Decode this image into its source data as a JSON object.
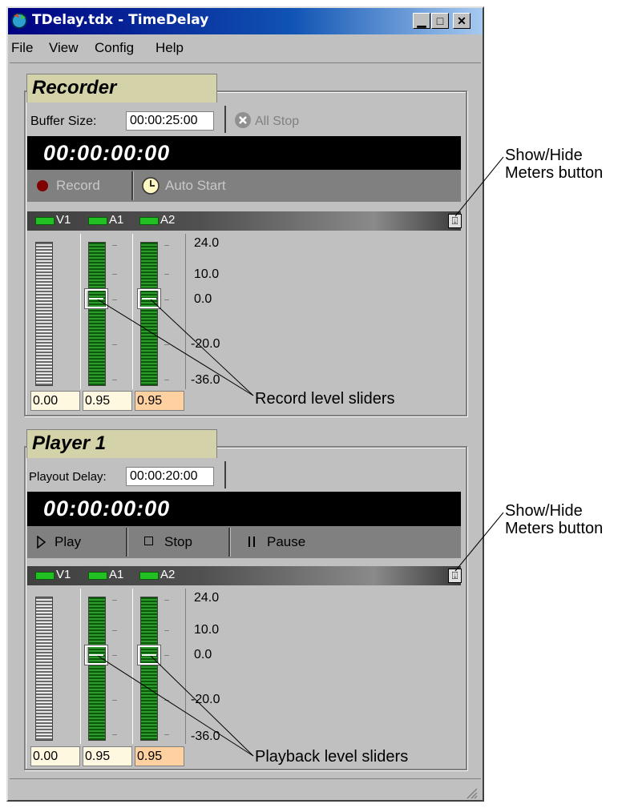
{
  "window": {
    "title": "TDelay.tdx - TimeDelay",
    "minimize": "▁",
    "maximize": "□",
    "close": "✕"
  },
  "menu": [
    "File",
    "View",
    "Config",
    "Help"
  ],
  "recorder": {
    "tab": "Recorder",
    "buffer_label": "Buffer Size:",
    "buffer_value": "00:00:25:00",
    "all_stop": "All Stop",
    "timecode": "00:00:00:00",
    "record": "Record",
    "auto_start": "Auto Start",
    "channels": [
      "V1",
      "A1",
      "A2"
    ],
    "scale": [
      "24.0",
      "10.0",
      "0.0",
      "-20.0",
      "-36.0"
    ],
    "values": [
      "0.00",
      "0.95",
      "0.95"
    ]
  },
  "player": {
    "tab": "Player 1",
    "delay_label": "Playout Delay:",
    "delay_value": "00:00:20:00",
    "timecode": "00:00:00:00",
    "play": "Play",
    "stop": "Stop",
    "pause": "Pause",
    "channels": [
      "V1",
      "A1",
      "A2"
    ],
    "scale": [
      "24.0",
      "10.0",
      "0.0",
      "-20.0",
      "-36.0"
    ],
    "values": [
      "0.00",
      "0.95",
      "0.95"
    ]
  },
  "annotations": {
    "show_hide_1": [
      "Show/Hide",
      "Meters button"
    ],
    "show_hide_2": [
      "Show/Hide",
      "Meters button"
    ],
    "record_sliders": "Record level sliders",
    "playback_sliders": "Playback level sliders"
  },
  "colors": {
    "title_bar": "#000080",
    "tab_bg": "#d4d2a8",
    "meter_green": "#2e9a2e",
    "value_box_a2": "#ffd0a0",
    "value_box": "#fff8e0"
  }
}
